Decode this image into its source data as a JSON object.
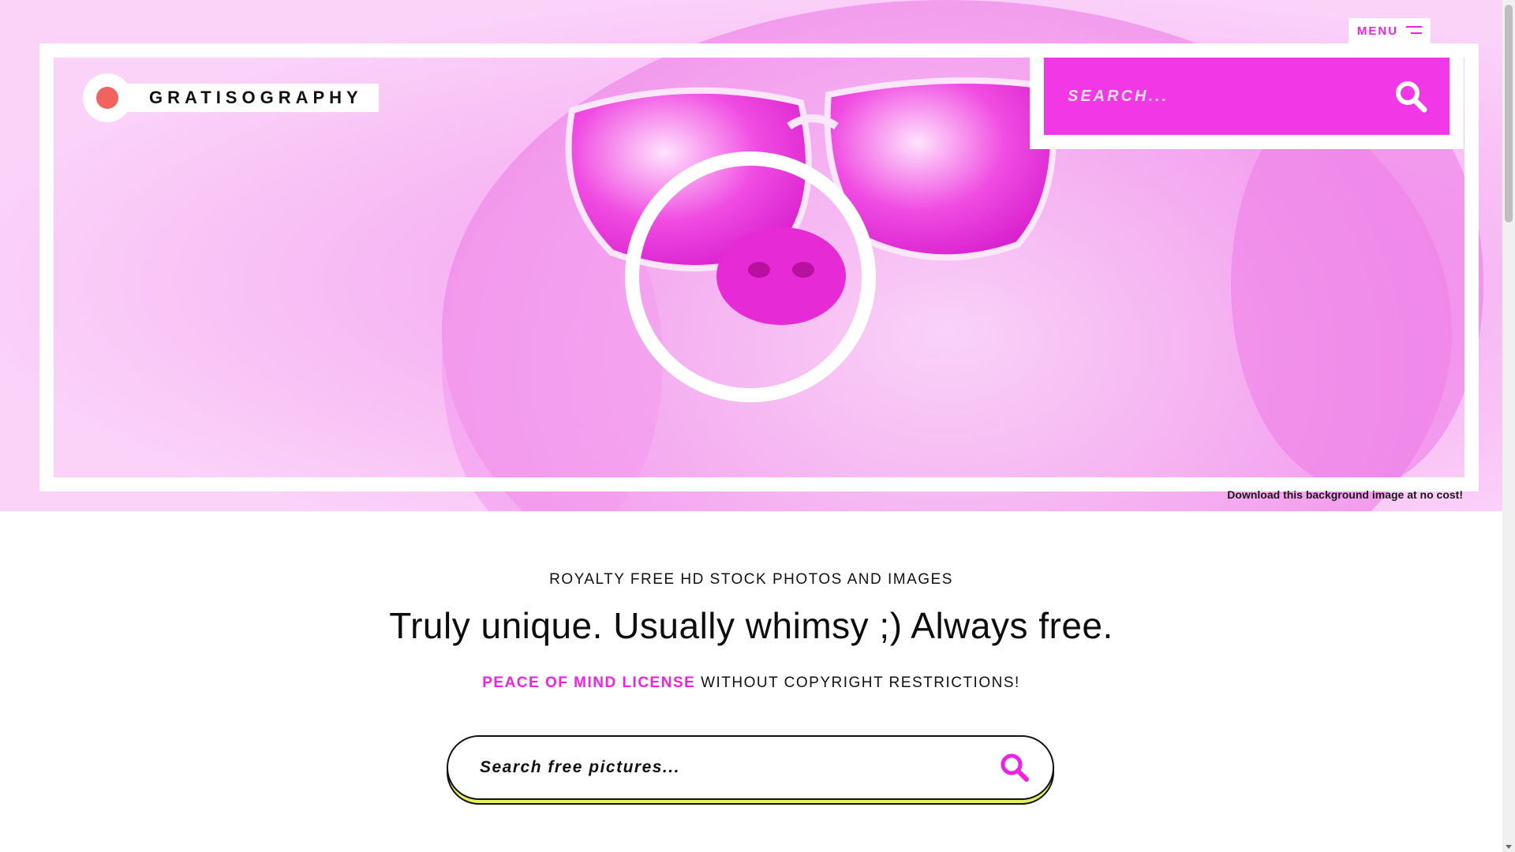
{
  "header": {
    "menu_label": "MENU",
    "logo_text": "GRATISOGRAPHY",
    "search_placeholder": "SEARCH...",
    "background_link": "Download this background image at no cost!"
  },
  "intro": {
    "kicker": "ROYALTY FREE HD STOCK PHOTOS AND IMAGES",
    "headline": "Truly unique. Usually whimsy ;) Always free.",
    "license_link": "PEACE OF MIND LICENSE",
    "license_rest": "WITHOUT COPYRIGHT RESTRICTIONS!"
  },
  "main_search": {
    "placeholder": "Search free pictures..."
  },
  "icons": {
    "top_search": "search-icon",
    "main_search": "search-icon",
    "menu": "hamburger-icon",
    "logo": "logo-dot-icon"
  },
  "colors": {
    "accent": "#f21fe5",
    "hero_tint": "#f6b4f3",
    "logo_dot": "#f0635f",
    "search_shadow": "#e6f05a"
  }
}
